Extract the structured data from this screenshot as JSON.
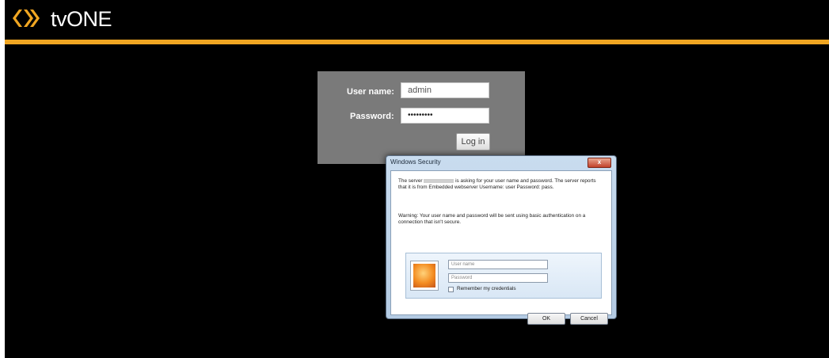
{
  "brand": {
    "name": "tvONE",
    "accent_color": "#f0a622",
    "logo_icon": "double-chevron-logo-icon"
  },
  "login_form": {
    "username_label": "User name:",
    "username_value": "admin",
    "password_label": "Password:",
    "password_value": "•••••••••",
    "login_button": "Log in"
  },
  "security_dialog": {
    "title": "Windows Security",
    "close_label": "x",
    "message_part1": "The server",
    "message_part2": "is asking for your user name and password. The server reports that it is from Embedded webserver Username: user Password: pass.",
    "warning": "Warning: Your user name and password will be sent using basic authentication on a connection that isn't secure.",
    "username_placeholder": "User name",
    "password_placeholder": "Password",
    "remember_label": "Remember my credentials",
    "ok_button": "OK",
    "cancel_button": "Cancel"
  }
}
